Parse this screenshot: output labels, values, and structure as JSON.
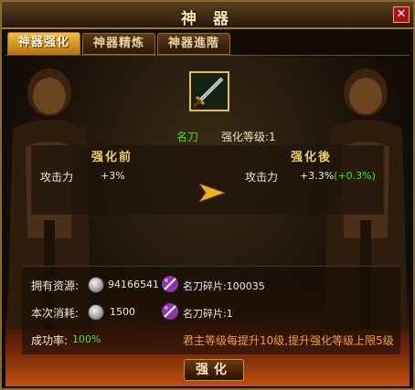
{
  "window": {
    "title": "神 器",
    "close_glyph": "✕"
  },
  "tabs": [
    {
      "label": "神器强化",
      "active": true
    },
    {
      "label": "神器精炼",
      "active": false
    },
    {
      "label": "神器進階",
      "active": false
    }
  ],
  "item": {
    "name": "名刀",
    "level_text": "强化等级:1",
    "icon": "sword-icon"
  },
  "before": {
    "heading": "强化前",
    "stat_label": "攻击力",
    "stat_value": "+3%"
  },
  "after": {
    "heading": "强化後",
    "stat_label": "攻击力",
    "stat_value": "+3.3%",
    "stat_bonus": "(+0.3%)"
  },
  "resources": {
    "owned_label": "拥有资源:",
    "owned_silver": "94166541",
    "owned_fragment": "名刀碎片:100035",
    "cost_label": "本次消耗:",
    "cost_silver": "1500",
    "cost_fragment": "名刀碎片:1"
  },
  "success": {
    "label": "成功率:",
    "value": "100%"
  },
  "notice": "君主等级每提升10级,提升强化等级上限5级",
  "button": {
    "label": "强化"
  },
  "colors": {
    "accent_gold": "#f0c040",
    "success_green": "#40e040",
    "notice_orange": "#f0a030"
  }
}
